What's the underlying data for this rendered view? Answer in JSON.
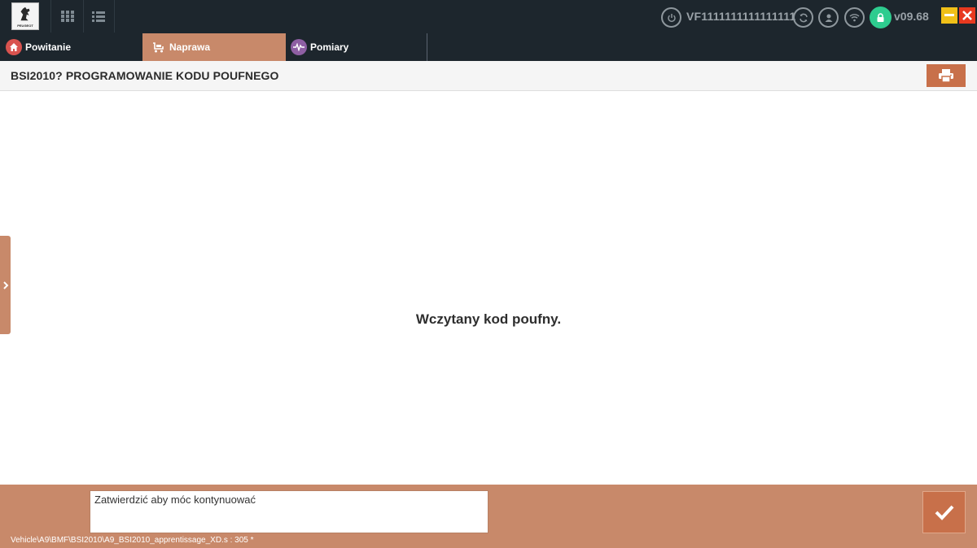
{
  "header": {
    "logo_text": "PEUGEOT",
    "vin": "VF1111111111111111",
    "version": "v09.68"
  },
  "tabs": [
    {
      "label": "Powitanie",
      "icon": "home-icon",
      "active": false
    },
    {
      "label": "Naprawa",
      "icon": "repair-icon",
      "active": true
    },
    {
      "label": "Pomiary",
      "icon": "pulse-icon",
      "active": false
    }
  ],
  "page": {
    "title": "BSI2010? PROGRAMOWANIE KODU POUFNEGO",
    "message": "Wczytany kod poufny."
  },
  "footer": {
    "prompt": "Zatwierdzić aby móc kontynuować",
    "path": "Vehicle\\A9\\BMF\\BSI2010\\A9_BSI2010_apprentissage_XD.s : 305 *"
  },
  "colors": {
    "topbar": "#1d262d",
    "accent": "#c8896a",
    "button": "#c8704a",
    "lock_green": "#2ecc8f",
    "minimize": "#f0c018",
    "close": "#e8391f"
  }
}
